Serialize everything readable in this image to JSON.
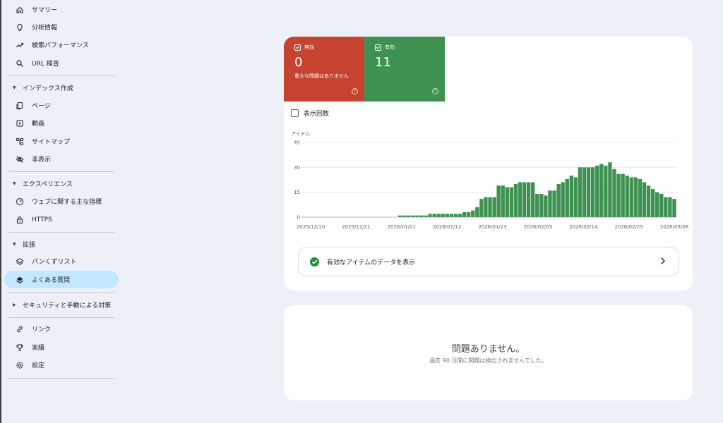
{
  "sidebar": {
    "items": [
      {
        "label": "サマリー",
        "icon": "home-icon"
      },
      {
        "label": "分析情報",
        "icon": "lightbulb-icon"
      },
      {
        "label": "検索パフォーマンス",
        "icon": "trending-up-icon"
      },
      {
        "label": "URL 検査",
        "icon": "search-icon"
      }
    ],
    "sections": [
      {
        "label": "インデックス作成",
        "items": [
          {
            "label": "ページ",
            "icon": "pages-icon"
          },
          {
            "label": "動画",
            "icon": "video-icon"
          },
          {
            "label": "サイトマップ",
            "icon": "sitemap-icon"
          },
          {
            "label": "非表示",
            "icon": "eye-off-icon"
          }
        ]
      },
      {
        "label": "エクスペリエンス",
        "items": [
          {
            "label": "ウェブに関する主な指標",
            "icon": "gauge-icon"
          },
          {
            "label": "HTTPS",
            "icon": "lock-icon"
          }
        ]
      },
      {
        "label": "拡張",
        "items": [
          {
            "label": "パンくずリスト",
            "icon": "layers-outline-icon"
          },
          {
            "label": "よくある質問",
            "icon": "layers-icon",
            "active": true
          }
        ]
      },
      {
        "label": "セキュリティと手動による対策",
        "collapsed": true
      }
    ],
    "bottom_items": [
      {
        "label": "リンク",
        "icon": "link-icon"
      },
      {
        "label": "実績",
        "icon": "trophy-icon"
      },
      {
        "label": "設定",
        "icon": "settings-icon"
      }
    ]
  },
  "status_tiles": {
    "invalid": {
      "label": "無効",
      "count": "0",
      "description": "重大な問題はありません",
      "color": "#c5432f"
    },
    "valid": {
      "label": "有効",
      "count": "11",
      "color": "#3f9152"
    }
  },
  "impressions_label": "表示回数",
  "chart_data": {
    "type": "bar",
    "ylabel": "アイテム",
    "yticks": [
      0,
      15,
      30,
      45
    ],
    "ylim": [
      0,
      45
    ],
    "xtick_labels": [
      "2025/12/10",
      "2025/12/21",
      "2026/01/01",
      "2026/01/12",
      "2026/01/23",
      "2026/02/03",
      "2026/02/14",
      "2026/02/25",
      "2026/03/08"
    ],
    "color": "#3f9152",
    "grid": true,
    "values": [
      0,
      0,
      0,
      0,
      0,
      0,
      0,
      0,
      0,
      0,
      0,
      0,
      0,
      0,
      0,
      0,
      0,
      0,
      0,
      0,
      0,
      0,
      1,
      1,
      1,
      1,
      1,
      1,
      1,
      2,
      2,
      2,
      2,
      2,
      2,
      2,
      2,
      3,
      3,
      4,
      6,
      11,
      12,
      12,
      12,
      19,
      19,
      18,
      18,
      20,
      21,
      21,
      21,
      21,
      14,
      14,
      13,
      16,
      16,
      20,
      21,
      23,
      25,
      24,
      30,
      30,
      30,
      30,
      31,
      32,
      31,
      33,
      29,
      26,
      26,
      25,
      24,
      24,
      23,
      21,
      19,
      17,
      15,
      14,
      12,
      12,
      11
    ],
    "values_note": null
  },
  "view_valid_label": "有効なアイテムのデータを表示",
  "issues": {
    "title": "問題ありません。",
    "subtitle": "過去 90 日間に問題は検出されませんでした。"
  }
}
